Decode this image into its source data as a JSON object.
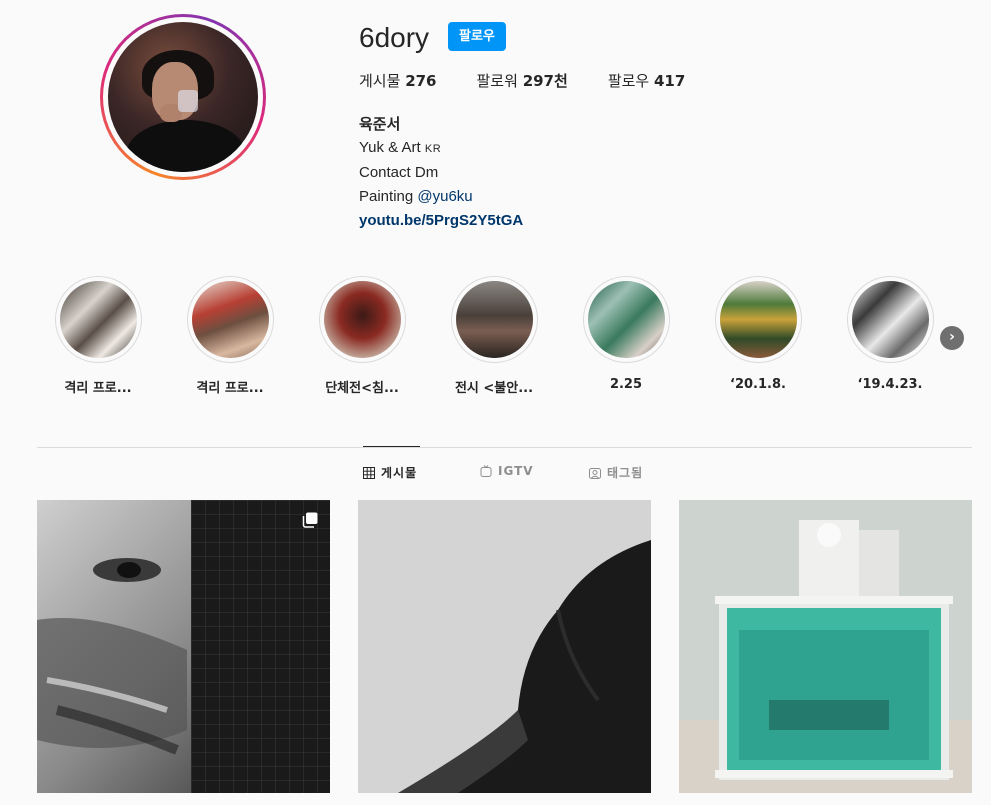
{
  "profile": {
    "username": "6dory",
    "follow_label": "팔로우",
    "stats": {
      "posts_label": "게시물",
      "posts_value": "276",
      "followers_label": "팔로워",
      "followers_value": "297천",
      "following_label": "팔로우",
      "following_value": "417"
    },
    "bio": {
      "full_name": "육준서",
      "line1": "Yuk & Art",
      "line1_suffix": "KR",
      "line2": "Contact Dm",
      "line3_prefix": "Painting ",
      "line3_mention": "@yu6ku",
      "link": "youtu.be/5PrgS2Y5tGA"
    }
  },
  "highlights": [
    {
      "label": "격리 프로..."
    },
    {
      "label": "격리 프로..."
    },
    {
      "label": "단체전<침..."
    },
    {
      "label": "전시 <불안..."
    },
    {
      "label": "2.25"
    },
    {
      "label": "‘20.1.8."
    },
    {
      "label": "‘19.4.23."
    }
  ],
  "tabs": [
    {
      "label": "게시물",
      "icon": "grid-icon",
      "active": true
    },
    {
      "label": "IGTV",
      "icon": "igtv-icon",
      "active": false
    },
    {
      "label": "태그됨",
      "icon": "tagged-icon",
      "active": false
    }
  ],
  "colors": {
    "accent": "#0095f6",
    "link": "#00376b",
    "text": "#262626",
    "muted": "#8e8e8e",
    "background": "#fafafa"
  }
}
